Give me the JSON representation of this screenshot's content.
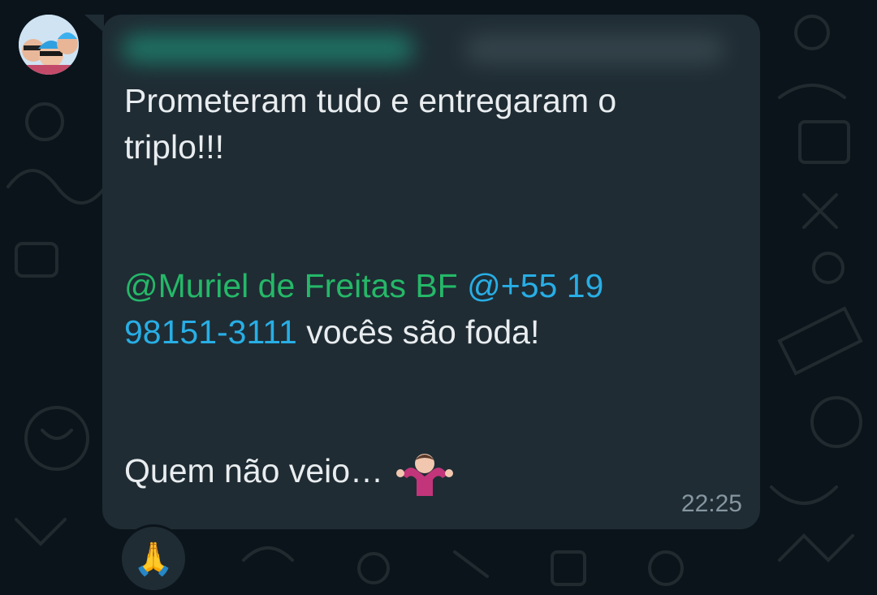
{
  "message": {
    "line1": "Prometeram tudo e entregaram o",
    "line2": "triplo!!!",
    "mention_name": "@Muriel de Freitas BF",
    "mention_phone_part1": "@+55 19",
    "mention_phone_part2": "98151-3111",
    "mention_suffix": " vocês são foda!",
    "last_line": "Quem não veio…",
    "time": "22:25"
  },
  "reaction": {
    "emoji": "🙏",
    "icon": "folded-hands-icon"
  },
  "inline_emoji": "shrug-icon",
  "colors": {
    "background": "#0b141a",
    "bubble": "#1f2c34",
    "text": "#e9edef",
    "mention_name": "#25b868",
    "mention_phone": "#28aee5",
    "timestamp": "#8696a0"
  }
}
